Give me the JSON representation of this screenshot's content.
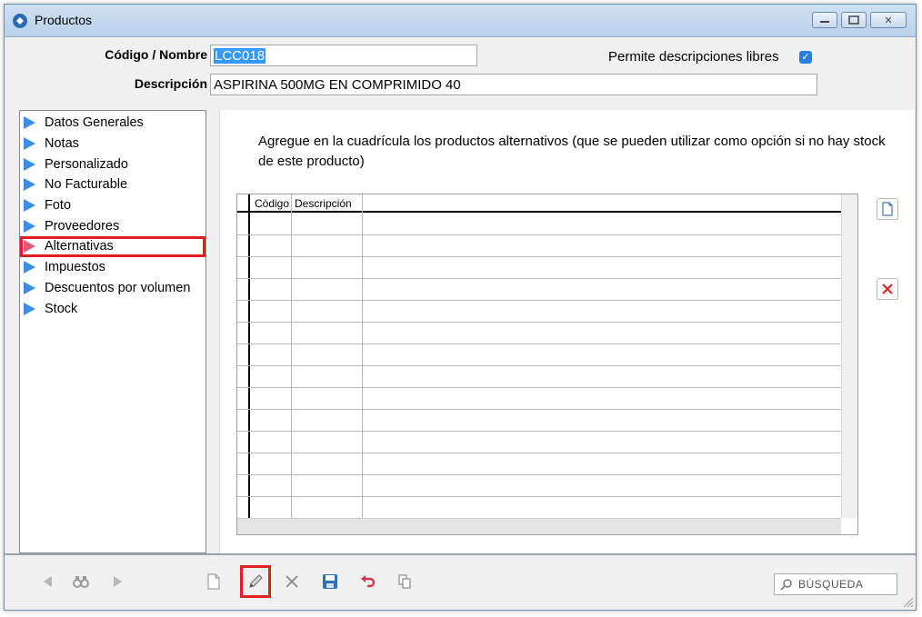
{
  "window": {
    "title": "Productos",
    "minimize_glyph": "▭",
    "maximize_glyph": "▣",
    "close_glyph": "✕"
  },
  "header": {
    "code_label": "Código / Nombre",
    "code_value": "LCC018",
    "description_label": "Descripción",
    "description_value": "ASPIRINA 500MG EN COMPRIMIDO 40",
    "free_descriptions_label": "Permite descripciones libres",
    "free_descriptions_checked": true
  },
  "sidebar": {
    "items": [
      {
        "label": "Datos Generales"
      },
      {
        "label": "Notas"
      },
      {
        "label": "Personalizado"
      },
      {
        "label": "No Facturable"
      },
      {
        "label": "Foto"
      },
      {
        "label": "Proveedores"
      },
      {
        "label": "Alternativas",
        "active": true
      },
      {
        "label": "Impuestos"
      },
      {
        "label": "Descuentos por volumen"
      },
      {
        "label": "Stock"
      }
    ]
  },
  "panel": {
    "instructions": "Agregue en la cuadrícula los productos alternativos (que se pueden utilizar como opción si no hay stock de este producto)",
    "grid": {
      "columns": [
        "Código",
        "Descripción"
      ],
      "rows": []
    }
  },
  "toolbar": {
    "search_placeholder": "BÚSQUEDA",
    "buttons": [
      "previous",
      "find",
      "next",
      "new",
      "edit",
      "delete",
      "save",
      "undo",
      "copy"
    ],
    "highlighted": "edit"
  },
  "colors": {
    "accent": "#3a8ee6",
    "highlight": "#e02020",
    "selection": "#3399ff",
    "delete_red": "#e02020"
  }
}
